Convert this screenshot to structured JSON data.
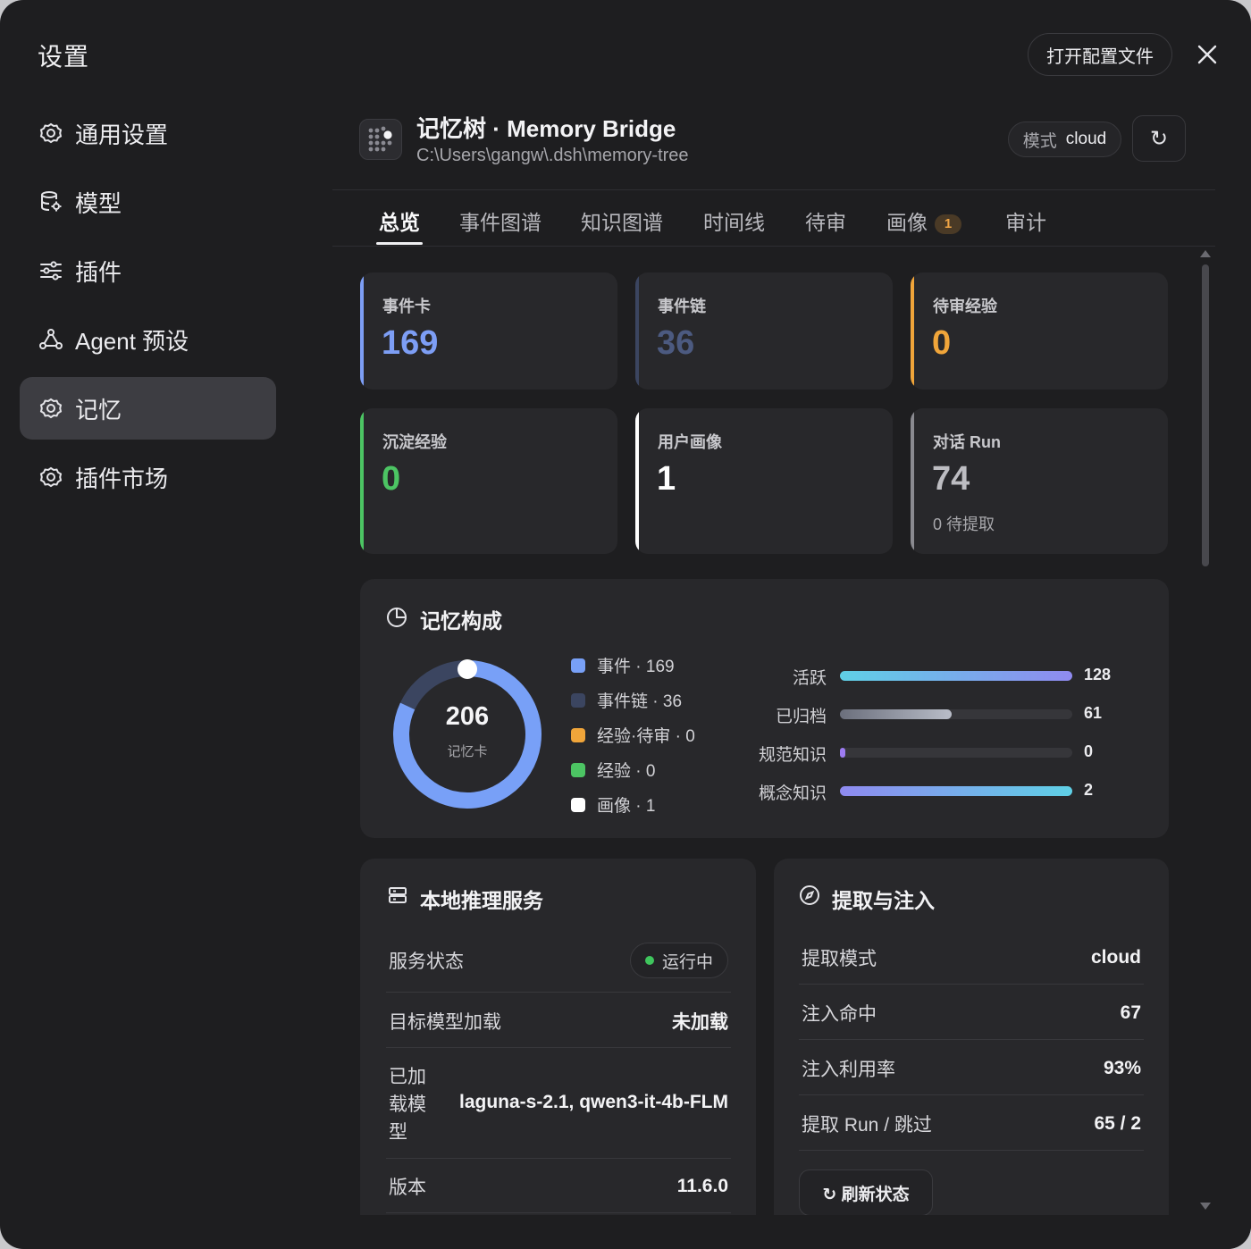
{
  "window": {
    "title": "设置",
    "open_config_label": "打开配置文件"
  },
  "sidebar": {
    "items": [
      {
        "label": "通用设置",
        "icon": "gear-icon"
      },
      {
        "label": "模型",
        "icon": "database-icon"
      },
      {
        "label": "插件",
        "icon": "sliders-icon"
      },
      {
        "label": "Agent 预设",
        "icon": "agent-network-icon"
      },
      {
        "label": "记忆",
        "icon": "gear-icon",
        "active": true
      },
      {
        "label": "插件市场",
        "icon": "gear-icon"
      }
    ]
  },
  "module": {
    "title": "记忆树 · Memory Bridge",
    "path": "C:\\Users\\gangw\\.dsh\\memory-tree",
    "mode_key": "模式",
    "mode_value": "cloud",
    "refresh_symbol": "↻"
  },
  "tabs": [
    {
      "label": "总览",
      "active": true
    },
    {
      "label": "事件图谱"
    },
    {
      "label": "知识图谱"
    },
    {
      "label": "时间线"
    },
    {
      "label": "待审"
    },
    {
      "label": "画像",
      "badge": "1"
    },
    {
      "label": "审计"
    }
  ],
  "stats": [
    {
      "label": "事件卡",
      "value": "169",
      "color": "#7d9ef5"
    },
    {
      "label": "事件链",
      "value": "36",
      "color": "#4c5a80"
    },
    {
      "label": "待审经验",
      "value": "0",
      "color": "#f0a53a"
    },
    {
      "label": "沉淀经验",
      "value": "0",
      "color": "#4cc463"
    },
    {
      "label": "用户画像",
      "value": "1",
      "color": "#ffffff"
    },
    {
      "label": "对话 Run",
      "value": "74",
      "sub": "0 待提取",
      "color": "#bdbdc2"
    }
  ],
  "composition": {
    "title": "记忆构成",
    "total": "206",
    "total_label": "记忆卡",
    "legend": [
      {
        "label": "事件 · 169",
        "color": "#78a0f7",
        "value": 169
      },
      {
        "label": "事件链 · 36",
        "color": "#3b4560",
        "value": 36
      },
      {
        "label": "经验·待审 · 0",
        "color": "#f0a53a",
        "value": 0
      },
      {
        "label": "经验 · 0",
        "color": "#4cc463",
        "value": 0
      },
      {
        "label": "画像 · 1",
        "color": "#ffffff",
        "value": 1
      }
    ],
    "bars": [
      {
        "label": "活跃",
        "value": "128",
        "fill_fraction": 1.0,
        "gradient": [
          "#5fd0e6",
          "#8f8af0"
        ]
      },
      {
        "label": "已归档",
        "value": "61",
        "fill_fraction": 0.48,
        "gradient": [
          "#6b6f7c",
          "#b9bdc8"
        ]
      },
      {
        "label": "规范知识",
        "value": "0",
        "fill_fraction": 0.02,
        "gradient": [
          "#9d7cf2",
          "#9d7cf2"
        ]
      },
      {
        "label": "概念知识",
        "value": "2",
        "fill_fraction": 1.0,
        "gradient": [
          "#8f8af0",
          "#5fd0e6"
        ]
      }
    ]
  },
  "local_service": {
    "title": "本地推理服务",
    "status_key": "服务状态",
    "status_value": "运行中",
    "target_key": "目标模型加载",
    "target_value": "未加载",
    "loaded_key_lines": [
      "已加",
      "载模",
      "型"
    ],
    "loaded_value": "laguna-s-2.1, qwen3-it-4b-FLM",
    "version_key": "版本",
    "version_value": "11.6.0"
  },
  "extraction": {
    "title": "提取与注入",
    "rows": [
      {
        "key": "提取模式",
        "value": "cloud"
      },
      {
        "key": "注入命中",
        "value": "67"
      },
      {
        "key": "注入利用率",
        "value": "93%"
      },
      {
        "key": "提取 Run / 跳过",
        "value": "65 / 2"
      }
    ],
    "refresh_label": "↻ 刷新状态"
  }
}
